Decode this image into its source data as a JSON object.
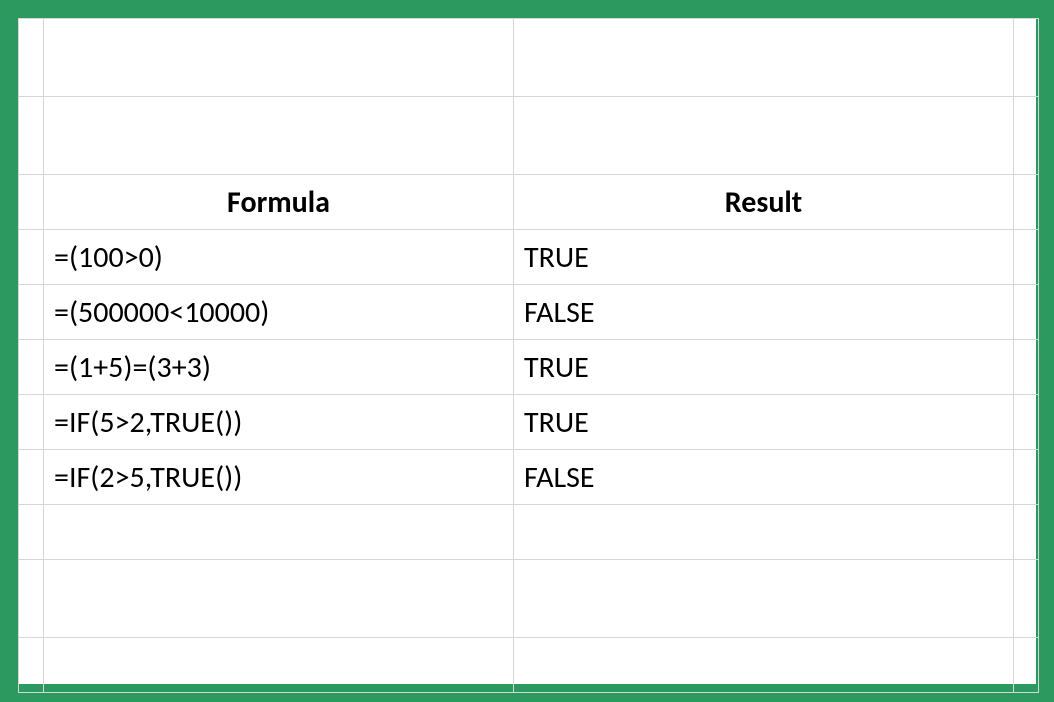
{
  "table": {
    "headers": {
      "formula": "Formula",
      "result": "Result"
    },
    "rows": [
      {
        "formula": "=(100>0)",
        "result": "TRUE"
      },
      {
        "formula": "=(500000<10000)",
        "result": "FALSE"
      },
      {
        "formula": "=(1+5)=(3+3)",
        "result": "TRUE"
      },
      {
        "formula": "=IF(5>2,TRUE())",
        "result": "TRUE"
      },
      {
        "formula": "=IF(2>5,TRUE())",
        "result": "FALSE"
      }
    ]
  }
}
